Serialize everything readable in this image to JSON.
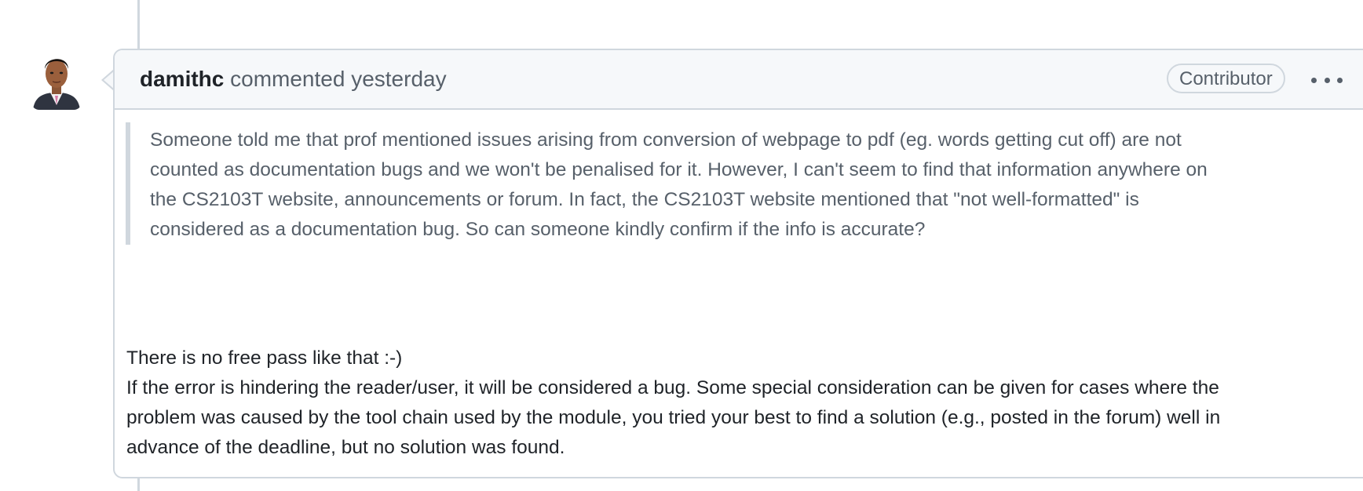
{
  "comment": {
    "author": "damithc",
    "action_text": "commented yesterday",
    "role_badge": "Contributor",
    "more_options_icon": "kebab-horizontal-icon",
    "avatar_icon": "user-avatar-icon",
    "quote": "Someone told me that prof mentioned issues arising from conversion of webpage to pdf (eg. words getting cut off) are not counted as documentation bugs and we won't be penalised for it. However, I can't seem to find that information anywhere on the CS2103T website, announcements or forum. In fact, the CS2103T website mentioned that \"not well-formatted\" is considered as a documentation bug. So can someone kindly confirm if the info is accurate?",
    "reply_line1": "There is no free pass like that :-)",
    "reply_line2": "If the error is hindering the reader/user, it will be considered a bug. Some special consideration can be given for cases where the problem was caused by the tool chain used by the module, you tried your best to find a solution (e.g., posted in the forum) well in advance of the deadline, but no solution was found."
  },
  "colors": {
    "border": "#d0d7de",
    "header_bg": "#f6f8fa",
    "muted_text": "#57606a",
    "primary_text": "#1f2328"
  }
}
